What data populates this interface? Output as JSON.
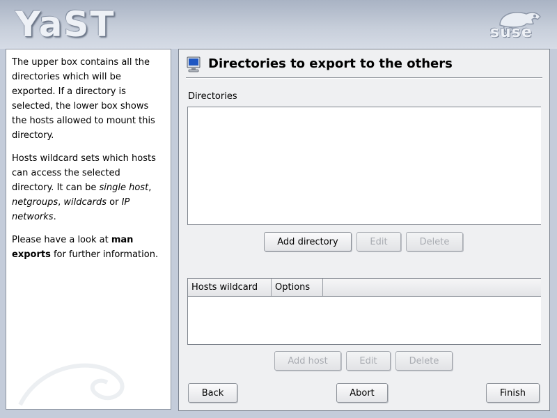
{
  "header": {
    "app_logo_text": "YaST",
    "vendor_logo_text": "suse"
  },
  "help": {
    "paragraphs": [
      "The upper box contains all the directories which will be exported. If a directory is selected, the lower box shows the hosts allowed to mount this directory.",
      [
        "Hosts wildcard sets which hosts can access the selected directory. It can be ",
        "single host",
        ", ",
        "netgroups",
        ", ",
        "wildcards",
        " or ",
        "IP networks",
        "."
      ],
      [
        "Please have a look at ",
        "man exports",
        " for further information."
      ]
    ]
  },
  "main": {
    "title": "Directories to export to the others",
    "directories_label": "Directories",
    "directories": [],
    "dir_buttons": {
      "add": "Add directory",
      "edit": "Edit",
      "delete": "Delete"
    },
    "hosts_table": {
      "columns": [
        "Hosts wildcard",
        "Options"
      ],
      "rows": []
    },
    "host_buttons": {
      "add": "Add host",
      "edit": "Edit",
      "delete": "Delete"
    }
  },
  "footer": {
    "back": "Back",
    "abort": "Abort",
    "finish": "Finish"
  }
}
